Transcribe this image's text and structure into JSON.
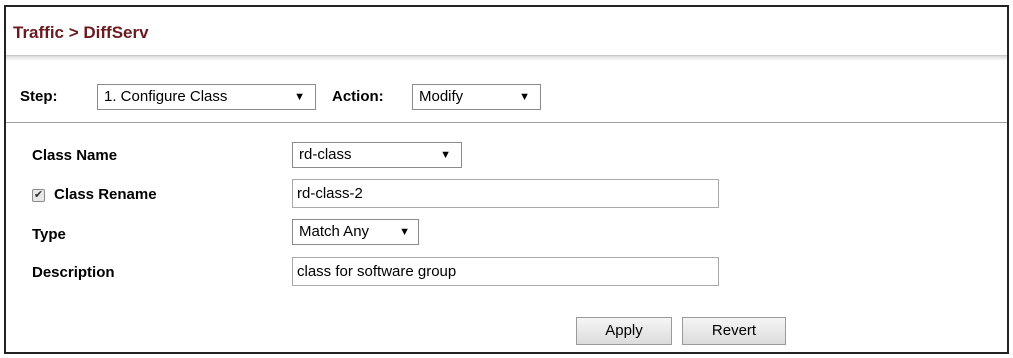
{
  "header": {
    "title": "Traffic > DiffServ"
  },
  "step_bar": {
    "step_label": "Step:",
    "step_value": "1. Configure Class",
    "action_label": "Action:",
    "action_value": "Modify"
  },
  "form": {
    "class_name_label": "Class Name",
    "class_name_value": "rd-class",
    "class_rename_label": "Class Rename",
    "class_rename_checked": true,
    "class_rename_value": "rd-class-2",
    "type_label": "Type",
    "type_value": "Match Any",
    "description_label": "Description",
    "description_value": "class for software group"
  },
  "buttons": {
    "apply": "Apply",
    "revert": "Revert"
  },
  "icons": {
    "dropdown": "chevron-down-icon",
    "checkbox": "checkmark-icon"
  }
}
